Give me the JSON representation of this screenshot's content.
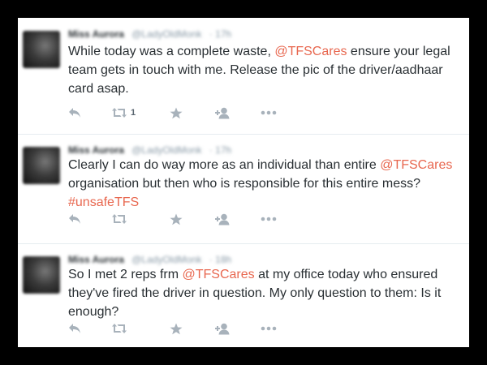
{
  "tweets": [
    {
      "name": "Miss Aurora",
      "handle": "@LadyOldMonk",
      "time": "17h",
      "parts": [
        {
          "text": "While today was a complete waste, "
        },
        {
          "text": "@TFSCares",
          "link": true
        },
        {
          "text": " ensure your legal team gets in touch with me. Release the pic of the driver/aadhaar card asap."
        }
      ],
      "retweets": "1"
    },
    {
      "name": "Miss Aurora",
      "handle": "@LadyOldMonk",
      "time": "17h",
      "parts": [
        {
          "text": "Clearly I can do way more as an individual than entire "
        },
        {
          "text": "@TFSCares",
          "link": true
        },
        {
          "text": " organisation but then who is responsible for this entire mess? "
        },
        {
          "text": "#unsafeTFS",
          "link": true
        }
      ],
      "retweets": ""
    },
    {
      "name": "Miss Aurora",
      "handle": "@LadyOldMonk",
      "time": "18h",
      "parts": [
        {
          "text": "So I met 2 reps frm "
        },
        {
          "text": "@TFSCares",
          "link": true
        },
        {
          "text": " at my office today who ensured they've fired the driver in question. My only question to them: Is it enough?"
        }
      ],
      "retweets": ""
    }
  ],
  "icons": {
    "reply": "reply-icon",
    "retweet": "retweet-icon",
    "favorite": "star-icon",
    "follow": "follow-icon",
    "more": "more-icon"
  },
  "colors": {
    "link": "#e8674f",
    "text": "#292f33",
    "icon": "#a8b2bb",
    "background": "#000000"
  }
}
